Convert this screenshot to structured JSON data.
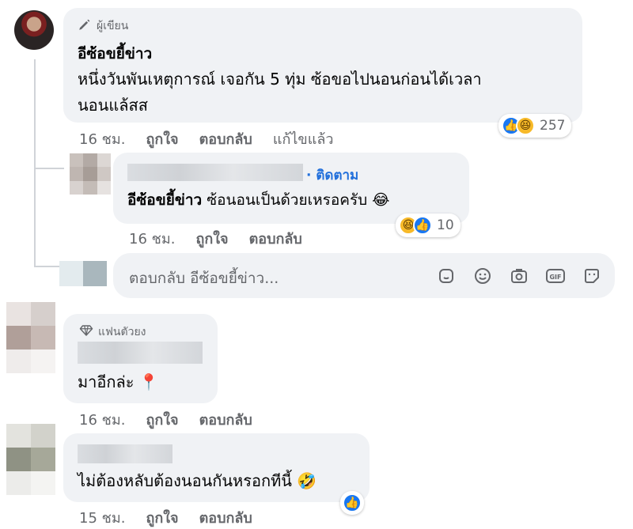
{
  "comment1": {
    "badge": "ผู้เขียน",
    "author": "อีซ้อขยี้ข่าว",
    "text_line1": "หนึ่งวันพันเหตุการณ์ เจอกัน 5 ทุ่ม ซ้อขอไปนอนก่อนได้เวลา",
    "text_line2": "นอนแล้สส",
    "time": "16 ชม.",
    "like": "ถูกใจ",
    "reply": "ตอบกลับ",
    "edited": "แก้ไขแล้ว",
    "reaction_count": "257"
  },
  "reply1": {
    "follow": "· ติดตาม",
    "mention": "อีซ้อขยี้ข่าว",
    "text": "ซ้อนอนเป็นด้วยเหรอครับ",
    "emoji": "😂",
    "time": "16 ชม.",
    "like": "ถูกใจ",
    "reply": "ตอบกลับ",
    "reaction_count": "10"
  },
  "reply_input": {
    "placeholder": "ตอบกลับ อีซ้อขยี้ข่าว..."
  },
  "comment2": {
    "badge": "แฟนตัวยง",
    "text": "มาอีกล่ะ",
    "emoji": "📍",
    "time": "16 ชม.",
    "like": "ถูกใจ",
    "reply": "ตอบกลับ"
  },
  "comment3": {
    "text": "ไม่ต้องหลับต้องนอนกันหรอกทีนี้",
    "emoji": "🤣",
    "time": "15 ชม.",
    "like": "ถูกใจ",
    "reply": "ตอบกลับ"
  },
  "icons": {
    "author_badge": "pencil-icon",
    "fan_badge": "diamond-icon",
    "input": [
      "sticker-icon",
      "emoji-icon",
      "camera-icon",
      "gif-icon",
      "sticker-face-icon"
    ]
  },
  "colors": {
    "bubble": "#f0f2f5",
    "meta_text": "#65676b",
    "like_blue": "#1877f2",
    "follow_blue": "#216fdb"
  }
}
